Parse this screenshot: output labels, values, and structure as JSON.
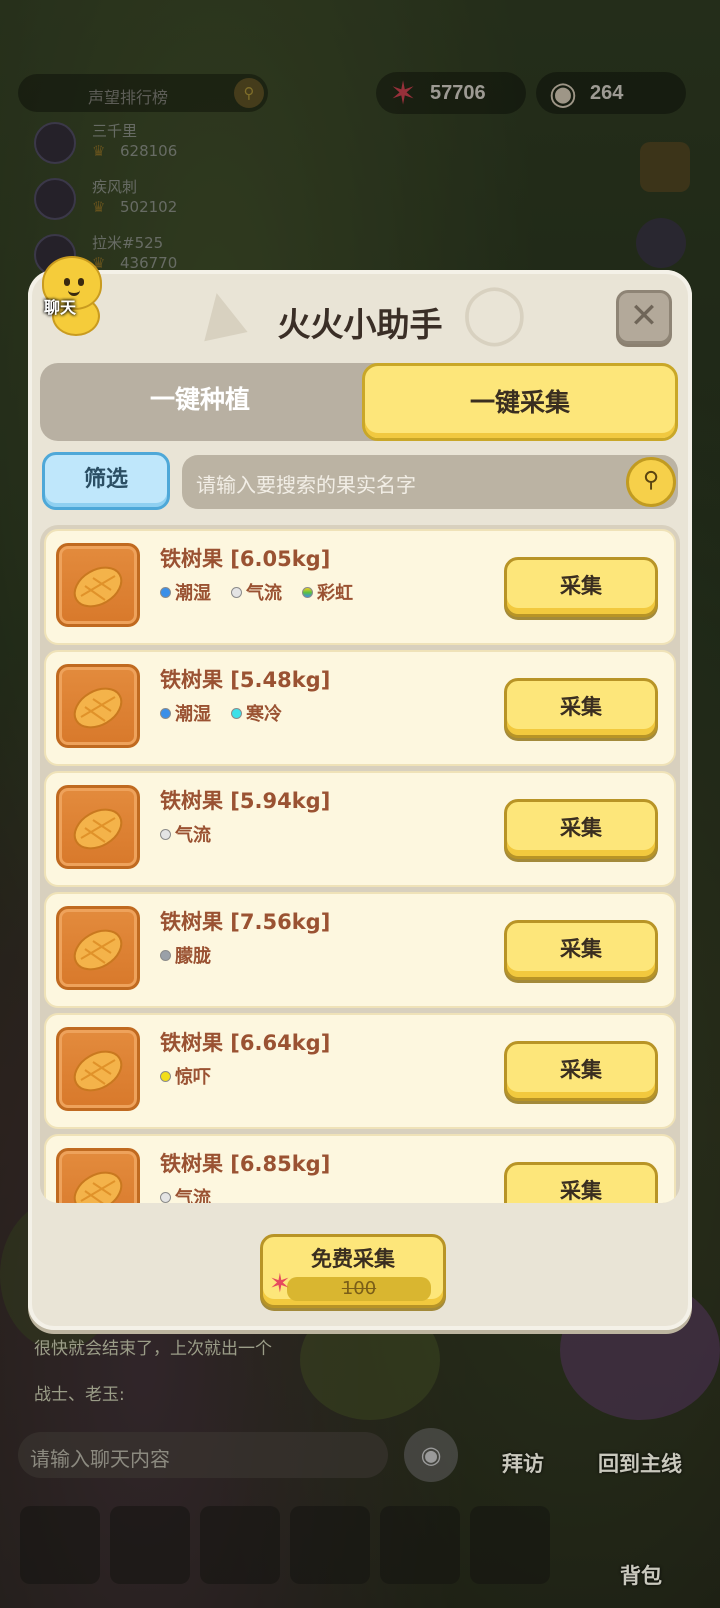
{
  "hud": {
    "rank_title": "声望排行榜",
    "currency_star": "57706",
    "currency_pearl": "264"
  },
  "ranking": [
    {
      "name": "三千里",
      "score": "628106"
    },
    {
      "name": "疾风刺",
      "score": "502102"
    },
    {
      "name": "拉米#525",
      "score": "436770"
    }
  ],
  "chat_bubble_label": "聊天",
  "modal": {
    "title": "火火小助手",
    "close_label": "✕",
    "tabs": [
      {
        "label": "一键种植",
        "active": false
      },
      {
        "label": "一键采集",
        "active": true
      }
    ],
    "filter_label": "筛选",
    "search_placeholder": "请输入要搜索的果实名字",
    "collect_label": "采集",
    "items": [
      {
        "name": "铁树果 [6.05kg]",
        "tags": [
          {
            "label": "潮湿",
            "color": "#3a8fe8"
          },
          {
            "label": "气流",
            "color": "#e4e4e4"
          },
          {
            "label": "彩虹",
            "color": "#9acb3a"
          }
        ]
      },
      {
        "name": "铁树果 [5.48kg]",
        "tags": [
          {
            "label": "潮湿",
            "color": "#3a8fe8"
          },
          {
            "label": "寒冷",
            "color": "#3de0e8"
          }
        ]
      },
      {
        "name": "铁树果 [5.94kg]",
        "tags": [
          {
            "label": "气流",
            "color": "#e4e4e4"
          }
        ]
      },
      {
        "name": "铁树果 [7.56kg]",
        "tags": [
          {
            "label": "朦胧",
            "color": "#9aa0a8"
          }
        ]
      },
      {
        "name": "铁树果 [6.64kg]",
        "tags": [
          {
            "label": "惊吓",
            "color": "#f2de1a"
          }
        ]
      },
      {
        "name": "铁树果 [6.85kg]",
        "tags": [
          {
            "label": "气流",
            "color": "#e4e4e4"
          }
        ]
      }
    ],
    "free_collect": {
      "label": "免费采集",
      "cost": "100"
    }
  },
  "chat": {
    "line1": "很快就会结束了，上次就出一个",
    "line2": "战士、老玉:",
    "input_placeholder": "请输入聊天内容"
  },
  "nav": {
    "visit": "拜访",
    "main_line": "回到主线",
    "backpack": "背包"
  }
}
